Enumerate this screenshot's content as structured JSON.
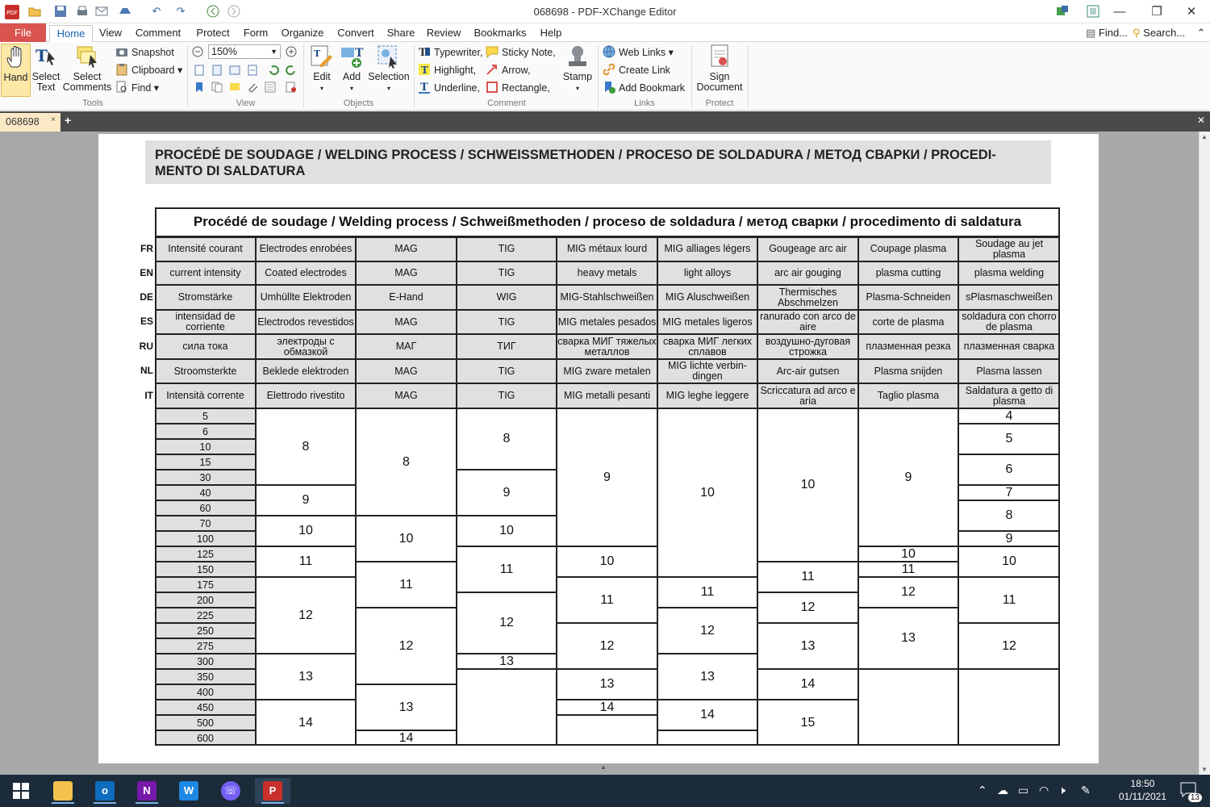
{
  "window": {
    "title": "068698 - PDF-XChange Editor"
  },
  "menu": {
    "tabs": [
      "File",
      "Home",
      "View",
      "Comment",
      "Protect",
      "Form",
      "Organize",
      "Convert",
      "Share",
      "Review",
      "Bookmarks",
      "Help"
    ],
    "find_label": "Find...",
    "search_label": "Search..."
  },
  "ribbon": {
    "tools": {
      "hand": "Hand",
      "select_text": "Select\nText",
      "select_comments": "Select\nComments",
      "snapshot": "Snapshot",
      "clipboard": "Clipboard",
      "find": "Find",
      "label": "Tools"
    },
    "view": {
      "zoom": "150%",
      "label": "View"
    },
    "objects": {
      "edit": "Edit",
      "add": "Add",
      "selection": "Selection",
      "label": "Objects"
    },
    "comment": {
      "typewriter": "Typewriter",
      "sticky_note": "Sticky Note",
      "highlight": "Highlight",
      "arrow": "Arrow",
      "underline": "Underline",
      "rectangle": "Rectangle",
      "stamp": "Stamp",
      "label": "Comment"
    },
    "links": {
      "web_links": "Web Links",
      "create_link": "Create Link",
      "add_bookmark": "Add Bookmark",
      "label": "Links"
    },
    "protect": {
      "sign_document": "Sign\nDocument",
      "label": "Protect"
    }
  },
  "doc_tab": "068698",
  "document": {
    "heading": "PROCÉDÉ DE SOUDAGE / WELDING PROCESS / SCHWEISSMETHODEN / PROCESO DE SOLDADURA / МЕТОД СВАРКИ / PROCEDI-\nMENTO DI SALDATURA",
    "table_title": "Procédé de soudage / Welding process / Schweißmethoden / proceso de soldadura / метод сварки / procedimento di saldatura",
    "languages": [
      "FR",
      "EN",
      "DE",
      "ES",
      "RU",
      "NL",
      "IT"
    ],
    "header_rows": [
      [
        "Intensité courant",
        "Electrodes enrobées",
        "MAG",
        "TIG",
        "MIG métaux lourd",
        "MIG alliages légers",
        "Gougeage arc air",
        "Coupage plasma",
        "Soudage au jet plasma"
      ],
      [
        "current intensity",
        "Coated electrodes",
        "MAG",
        "TIG",
        "heavy metals",
        "light alloys",
        "arc air gouging",
        "plasma cutting",
        "plasma welding"
      ],
      [
        "Stromstärke",
        "Umhüllte Elektroden",
        "E-Hand",
        "WIG",
        "MIG-Stahlschweißen",
        "MIG Aluschweißen",
        "Thermisches Abschmelzen",
        "Plasma-Schneiden",
        "sPlasmaschweißen"
      ],
      [
        "intensidad de corriente",
        "Electrodos revestidos",
        "MAG",
        "TIG",
        "MIG metales pesados",
        "MIG metales ligeros",
        "ranurado con arco de aire",
        "corte de plasma",
        "soldadura con chorro de plasma"
      ],
      [
        "сила тока",
        "электроды с обмазкой",
        "МАГ",
        "ТИГ",
        "сварка МИГ тяжелых металлов",
        "сварка МИГ легких сплавов",
        "воздушно-дуговая строжка",
        "плазменная резка",
        "плазменная сварка"
      ],
      [
        "Stroomsterkte",
        "Beklede elektroden",
        "MAG",
        "TIG",
        "MIG zware metalen",
        "MIG lichte verbin-\ndingen",
        "Arc-air gutsen",
        "Plasma snijden",
        "Plasma lassen"
      ],
      [
        "Intensità corrente",
        "Elettrodo rivestito",
        "MAG",
        "TIG",
        "MIG metalli pesanti",
        "MIG leghe leggere",
        "Scriccatura ad arco e aria",
        "Taglio plasma",
        "Saldatura a getto di plasma"
      ]
    ],
    "amperages": [
      "5",
      "6",
      "10",
      "15",
      "30",
      "40",
      "60",
      "70",
      "100",
      "125",
      "150",
      "175",
      "200",
      "225",
      "250",
      "275",
      "300",
      "350",
      "400",
      "450",
      "500",
      "600"
    ],
    "shade_columns": [
      [
        {
          "from": 0,
          "to": 4,
          "v": "8"
        },
        {
          "from": 5,
          "to": 6,
          "v": "9"
        },
        {
          "from": 7,
          "to": 8,
          "v": "10"
        },
        {
          "from": 9,
          "to": 10,
          "v": "11"
        },
        {
          "from": 11,
          "to": 15,
          "v": "12"
        },
        {
          "from": 16,
          "to": 18,
          "v": "13"
        },
        {
          "from": 19,
          "to": 21,
          "v": "14"
        }
      ],
      [
        {
          "from": 0,
          "to": 6,
          "v": "8"
        },
        {
          "from": 7,
          "to": 9,
          "v": "10"
        },
        {
          "from": 10,
          "to": 12,
          "v": "11"
        },
        {
          "from": 13,
          "to": 17,
          "v": "12"
        },
        {
          "from": 18,
          "to": 20,
          "v": "13"
        },
        {
          "from": 21,
          "to": 21,
          "v": "14"
        }
      ],
      [
        {
          "from": 0,
          "to": 3,
          "v": "8"
        },
        {
          "from": 4,
          "to": 6,
          "v": "9"
        },
        {
          "from": 7,
          "to": 8,
          "v": "10"
        },
        {
          "from": 9,
          "to": 11,
          "v": "11"
        },
        {
          "from": 12,
          "to": 15,
          "v": "12"
        },
        {
          "from": 16,
          "to": 16,
          "v": "13"
        },
        {
          "from": 17,
          "to": 21,
          "v": ""
        }
      ],
      [
        {
          "from": 0,
          "to": 8,
          "v": "9"
        },
        {
          "from": 9,
          "to": 10,
          "v": "10"
        },
        {
          "from": 11,
          "to": 13,
          "v": "11"
        },
        {
          "from": 14,
          "to": 16,
          "v": "12"
        },
        {
          "from": 17,
          "to": 18,
          "v": "13"
        },
        {
          "from": 19,
          "to": 19,
          "v": "14"
        },
        {
          "from": 20,
          "to": 21,
          "v": ""
        }
      ],
      [
        {
          "from": 0,
          "to": 10,
          "v": "10"
        },
        {
          "from": 11,
          "to": 12,
          "v": "11"
        },
        {
          "from": 13,
          "to": 15,
          "v": "12"
        },
        {
          "from": 16,
          "to": 18,
          "v": "13"
        },
        {
          "from": 19,
          "to": 20,
          "v": "14"
        },
        {
          "from": 21,
          "to": 21,
          "v": ""
        }
      ],
      [
        {
          "from": 0,
          "to": 9,
          "v": "10"
        },
        {
          "from": 10,
          "to": 11,
          "v": "11"
        },
        {
          "from": 12,
          "to": 13,
          "v": "12"
        },
        {
          "from": 14,
          "to": 16,
          "v": "13"
        },
        {
          "from": 17,
          "to": 18,
          "v": "14"
        },
        {
          "from": 19,
          "to": 21,
          "v": "15"
        }
      ],
      [
        {
          "from": 0,
          "to": 8,
          "v": "9"
        },
        {
          "from": 9,
          "to": 9,
          "v": "10"
        },
        {
          "from": 10,
          "to": 10,
          "v": "11"
        },
        {
          "from": 11,
          "to": 12,
          "v": "12"
        },
        {
          "from": 13,
          "to": 16,
          "v": "13"
        },
        {
          "from": 17,
          "to": 21,
          "v": ""
        }
      ],
      [
        {
          "from": 0,
          "to": 0,
          "v": "4"
        },
        {
          "from": 1,
          "to": 2,
          "v": "5"
        },
        {
          "from": 3,
          "to": 4,
          "v": "6"
        },
        {
          "from": 5,
          "to": 5,
          "v": "7"
        },
        {
          "from": 6,
          "to": 7,
          "v": "8"
        },
        {
          "from": 8,
          "to": 8,
          "v": "9"
        },
        {
          "from": 9,
          "to": 10,
          "v": "10"
        },
        {
          "from": 11,
          "to": 13,
          "v": "11"
        },
        {
          "from": 14,
          "to": 16,
          "v": "12"
        },
        {
          "from": 17,
          "to": 21,
          "v": ""
        }
      ]
    ]
  },
  "taskbar": {
    "time": "18:50",
    "date": "01/11/2021",
    "notifications": "13"
  },
  "colors": {
    "file_tab": "#d9534f",
    "active_tab_text": "#1a63b5",
    "doc_tab": "#fbe9c6",
    "taskbar": "#1c2b3a",
    "header_shade": "#e0e0e0"
  }
}
